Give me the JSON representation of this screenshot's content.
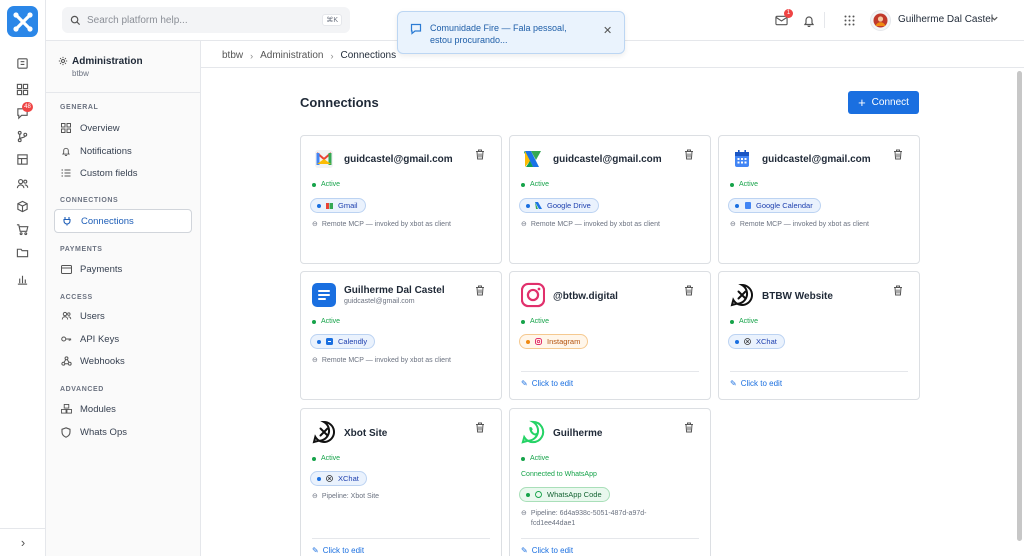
{
  "search": {
    "placeholder": "Search platform help...",
    "shortcut": "⌘K"
  },
  "rail": {
    "badge_count": "48",
    "expand_glyph": "›"
  },
  "topbar": {
    "mail_badge": "1",
    "user_name": "Guilherme Dal Castel"
  },
  "toast": {
    "text": "Comunidade Fire — Fala pessoal, estou procurando..."
  },
  "sidebar": {
    "title": "Administration",
    "subtitle": "btbw",
    "sections": [
      {
        "label": "GENERAL",
        "items": [
          {
            "label": "Overview",
            "icon": "grid-icon"
          },
          {
            "label": "Notifications",
            "icon": "bell-icon"
          },
          {
            "label": "Custom fields",
            "icon": "list-icon"
          }
        ]
      },
      {
        "label": "CONNECTIONS",
        "items": [
          {
            "label": "Connections",
            "icon": "plug-icon",
            "active": true
          }
        ]
      },
      {
        "label": "PAYMENTS",
        "items": [
          {
            "label": "Payments",
            "icon": "card-icon"
          }
        ]
      },
      {
        "label": "ACCESS",
        "items": [
          {
            "label": "Users",
            "icon": "users-icon"
          },
          {
            "label": "API Keys",
            "icon": "key-icon"
          },
          {
            "label": "Webhooks",
            "icon": "webhook-icon"
          }
        ]
      },
      {
        "label": "ADVANCED",
        "items": [
          {
            "label": "Modules",
            "icon": "modules-icon"
          },
          {
            "label": "Whats Ops",
            "icon": "shield-icon"
          }
        ]
      }
    ]
  },
  "breadcrumb": {
    "items": [
      "btbw",
      "Administration",
      "Connections"
    ]
  },
  "page": {
    "title": "Connections",
    "connect_label": "Connect"
  },
  "cards": [
    {
      "title": "guidcastel@gmail.com",
      "status": "Active",
      "chip": "Gmail",
      "note": "Remote MCP — invoked by xbot as client"
    },
    {
      "title": "guidcastel@gmail.com",
      "status": "Active",
      "chip": "Google Drive",
      "note": "Remote MCP — invoked by xbot as client"
    },
    {
      "title": "guidcastel@gmail.com",
      "status": "Active",
      "chip": "Google Calendar",
      "note": "Remote MCP — invoked by xbot as client"
    },
    {
      "title": "Guilherme Dal Castel",
      "subtitle": "guidcastel@gmail.com",
      "status": "Active",
      "chip": "Calendly",
      "note": "Remote MCP — invoked by xbot as client"
    },
    {
      "title": "@btbw.digital",
      "status": "Active",
      "chip": "Instagram",
      "edit": "Click to edit"
    },
    {
      "title": "BTBW Website",
      "status": "Active",
      "chip": "XChat",
      "edit": "Click to edit"
    },
    {
      "title": "Xbot Site",
      "status": "Active",
      "chip": "XChat",
      "note": "Pipeline: Xbot Site",
      "edit": "Click to edit"
    },
    {
      "title": "Guilherme",
      "status": "Active",
      "status2": "Connected to WhatsApp",
      "chip": "WhatsApp Code",
      "note": "Pipeline: 6d4a938c-5051-487d-a97d-fcd1ee44dae1",
      "edit": "Click to edit"
    }
  ],
  "colors": {
    "accent": "#1a6fe0",
    "active": "#16a34a",
    "logo": "#2b87e8"
  }
}
